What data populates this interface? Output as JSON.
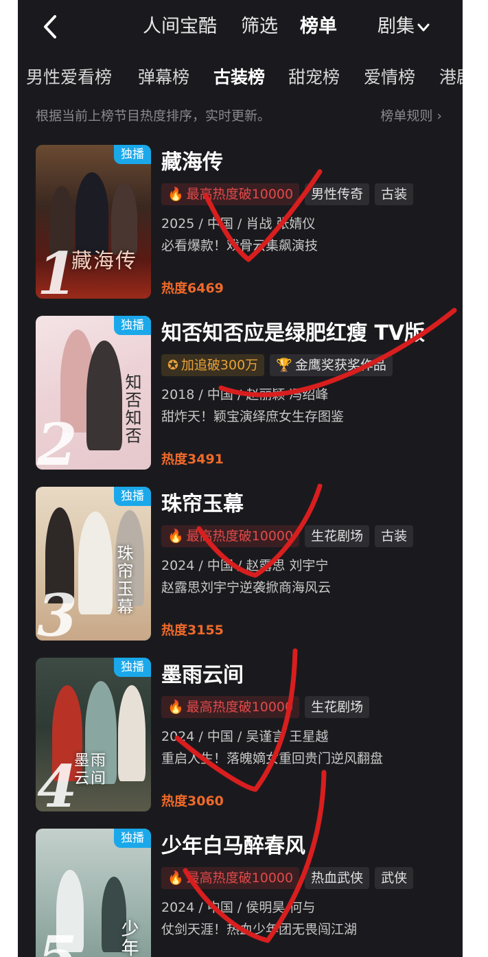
{
  "topnav": {
    "tabs": [
      {
        "label": "人间宝酷"
      },
      {
        "label": "筛选"
      },
      {
        "label": "榜单"
      }
    ],
    "dropdown_label": "剧集"
  },
  "categories": [
    {
      "label": "男性爱看榜"
    },
    {
      "label": "弹幕榜"
    },
    {
      "label": "古装榜"
    },
    {
      "label": "甜宠榜"
    },
    {
      "label": "爱情榜"
    },
    {
      "label": "港剧"
    }
  ],
  "subtitle": "根据当前上榜节目热度排序，实时更新。",
  "rules_link": "榜单规则 ›",
  "colors": {
    "background": "#1a1a1e",
    "badge": "#1aa8ea",
    "heat": "#f06a2a",
    "hot_tag": "#e14a4a",
    "annotation_red": "#d81e1e"
  },
  "items": [
    {
      "rank": "1",
      "badge": "独播",
      "poster_title": "藏海传",
      "title": "藏海传",
      "tags": [
        "最高热度破10000",
        "男性传奇",
        "古装"
      ],
      "meta": "2025 / 中国 / 肖战 张婧仪",
      "desc": "必看爆款！戏骨云集飙演技",
      "heat": "热度6469"
    },
    {
      "rank": "2",
      "badge": "独播",
      "poster_title": "知否知否",
      "title": "知否知否应是绿肥红瘦 TV版",
      "tags": [
        "加追破300万",
        "金鹰奖获奖作品"
      ],
      "meta": "2018 / 中国 / 赵丽颖 冯绍峰",
      "desc": "甜炸天！颖宝演绎庶女生存图鉴",
      "heat": "热度3491"
    },
    {
      "rank": "3",
      "badge": "独播",
      "poster_title": "珠帘玉幕",
      "title": "珠帘玉幕",
      "tags": [
        "最高热度破10000",
        "生花剧场",
        "古装"
      ],
      "meta": "2024 / 中国 / 赵露思 刘宇宁",
      "desc": "赵露思刘宇宁逆袭掀商海风云",
      "heat": "热度3155"
    },
    {
      "rank": "4",
      "badge": "独播",
      "poster_title": "墨雨云间",
      "title": "墨雨云间",
      "tags": [
        "最高热度破10000",
        "生花剧场"
      ],
      "meta": "2024 / 中国 / 吴谨言 王星越",
      "desc": "重启人生！落魄嫡女重回贵门逆风翻盘",
      "heat": "热度3060"
    },
    {
      "rank": "5",
      "badge": "独播",
      "poster_title": "少年白马",
      "title": "少年白马醉春风",
      "tags": [
        "最高热度破10000",
        "热血武侠",
        "武侠"
      ],
      "meta": "2024 / 中国 / 侯明昊 何与",
      "desc": "仗剑天涯！热血少年团无畏闯江湖",
      "heat": ""
    }
  ]
}
